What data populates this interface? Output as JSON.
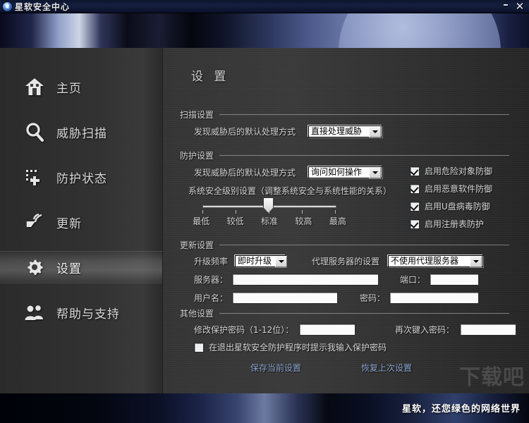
{
  "window": {
    "title": "星软安全中心",
    "app_icon": "shield-icon",
    "minimize_label": "–",
    "close_label": "✕"
  },
  "sidebar": {
    "items": [
      {
        "label": "主页",
        "icon": "home-icon",
        "active": false
      },
      {
        "label": "威胁扫描",
        "icon": "magnifier-icon",
        "active": false
      },
      {
        "label": "防护状态",
        "icon": "shield-plus-icon",
        "active": false
      },
      {
        "label": "更新",
        "icon": "satellite-icon",
        "active": false
      },
      {
        "label": "设置",
        "icon": "gear-icon",
        "active": true
      },
      {
        "label": "帮助与支持",
        "icon": "people-icon",
        "active": false
      }
    ]
  },
  "page": {
    "title": "设 置"
  },
  "scan_settings": {
    "section_title": "扫描设置",
    "default_action_label": "发现威胁后的默认处理方式",
    "default_action_value": "直接处理威胁"
  },
  "protect_settings": {
    "section_title": "防护设置",
    "default_action_label": "发现威胁后的默认处理方式",
    "default_action_value": "询问如何操作",
    "security_level_label": "系统安全级别设置（调整系统安全与系统性能的关系）",
    "slider_levels": [
      "最低",
      "较低",
      "标准",
      "较高",
      "最高"
    ],
    "slider_value": "标准",
    "slider_index": 2,
    "checkboxes": [
      {
        "label": "启用危险对象防御",
        "checked": true
      },
      {
        "label": "启用恶意软件防御",
        "checked": true
      },
      {
        "label": "启用U盘病毒防御",
        "checked": true
      },
      {
        "label": "启用注册表防护",
        "checked": true
      }
    ]
  },
  "update_settings": {
    "section_title": "更新设置",
    "frequency_label": "升级频率",
    "frequency_value": "即时升级",
    "proxy_label": "代理服务器的设置",
    "proxy_value": "不使用代理服务器",
    "server_label": "服务器：",
    "server_value": "",
    "port_label": "端口：",
    "port_value": "",
    "username_label": "用户名：",
    "username_value": "",
    "password_label": "密码：",
    "password_value": ""
  },
  "other_settings": {
    "section_title": "其他设置",
    "change_password_label": "修改保护密码（1-12位）：",
    "change_password_value": "",
    "confirm_password_label": "再次键入密码：",
    "confirm_password_value": "",
    "exit_prompt_label": "在退出星软安全防护程序时提示我输入保护密码",
    "exit_prompt_checked": false
  },
  "actions": {
    "save_label": "保存当前设置",
    "restore_label": "恢复上次设置"
  },
  "footer": {
    "slogan": "星软，还您绿色的网络世界"
  },
  "watermark": {
    "text": "下载吧"
  },
  "colors": {
    "accent_link": "#8ba3cd",
    "sidebar_bg": "#323232",
    "content_bg": "#343434",
    "title_bar": "#14203f"
  }
}
